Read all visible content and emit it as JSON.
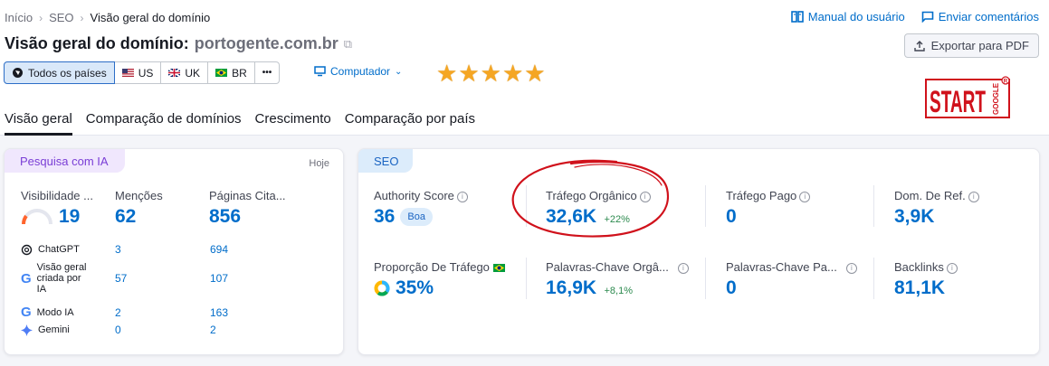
{
  "breadcrumb": {
    "home": "Início",
    "section": "SEO",
    "current": "Visão geral do domínio"
  },
  "toplinks": {
    "manual": "Manual do usuário",
    "feedback": "Enviar comentários"
  },
  "title": {
    "prefix": "Visão geral do domínio:",
    "domain": "portogente.com.br"
  },
  "export_label": "Exportar para PDF",
  "countries": [
    {
      "label": "Todos os países",
      "icon": "globe-icon",
      "active": true
    },
    {
      "label": "US",
      "icon": "us-flag-icon",
      "active": false
    },
    {
      "label": "UK",
      "icon": "uk-flag-icon",
      "active": false
    },
    {
      "label": "BR",
      "icon": "br-flag-icon",
      "active": false
    },
    {
      "label": "•••",
      "icon": "more-icon",
      "active": false
    }
  ],
  "device": {
    "label": "Computador",
    "icon": "monitor-icon"
  },
  "rating": {
    "stars": 5,
    "max": 5
  },
  "logo_text": "START GOOGLE",
  "tabs": [
    {
      "label": "Visão geral",
      "active": true
    },
    {
      "label": "Comparação de domínios",
      "active": false
    },
    {
      "label": "Crescimento",
      "active": false
    },
    {
      "label": "Comparação por país",
      "active": false
    }
  ],
  "ai_card": {
    "chip": "Pesquisa com IA",
    "today": "Hoje",
    "metrics": [
      {
        "label": "Visibilidade ...",
        "value": "19"
      },
      {
        "label": "Menções",
        "value": "62"
      },
      {
        "label": "Páginas Cita...",
        "value": "856"
      }
    ],
    "rows": [
      {
        "name": "ChatGPT",
        "icon": "chatgpt-icon",
        "mentions": "3",
        "pages": "694"
      },
      {
        "name": "Visão geral criada por IA",
        "icon": "google-icon",
        "mentions": "57",
        "pages": "107"
      },
      {
        "name": "Modo IA",
        "icon": "google-icon",
        "mentions": "2",
        "pages": "163"
      },
      {
        "name": "Gemini",
        "icon": "gemini-icon",
        "mentions": "0",
        "pages": "2"
      }
    ]
  },
  "seo_card": {
    "chip": "SEO",
    "metrics": [
      {
        "label": "Authority Score",
        "value": "36",
        "badge": "Boa"
      },
      {
        "label": "Tráfego Orgânico",
        "value": "32,6K",
        "delta": "+22%"
      },
      {
        "label": "Tráfego Pago",
        "value": "0"
      },
      {
        "label": "Dom. De Ref.",
        "value": "3,9K"
      },
      {
        "label": "Proporção De Tráfego",
        "value": "35%"
      },
      {
        "label": "Palavras-Chave Orgâ...",
        "value": "16,9K",
        "delta": "+8,1%"
      },
      {
        "label": "Palavras-Chave Pa...",
        "value": "0"
      },
      {
        "label": "Backlinks",
        "value": "81,1K"
      }
    ]
  },
  "colors": {
    "accent": "#006dca",
    "ai_chip": "#f0e7fd",
    "seo_chip": "#dcecfb",
    "highlight_circle": "#d0111b",
    "stars": "#f5a623",
    "logo": "#d0111b"
  }
}
